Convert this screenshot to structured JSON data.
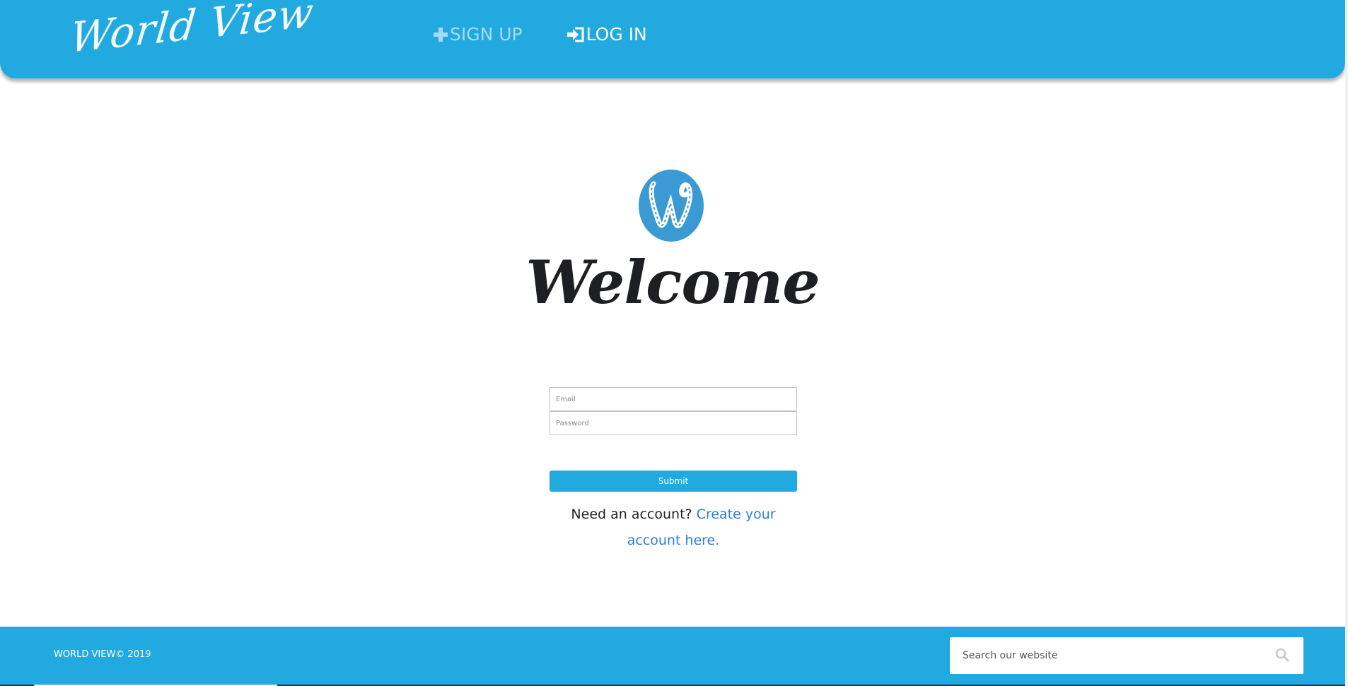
{
  "header": {
    "brand": "World View",
    "nav": {
      "signup_label": "SIGN UP",
      "login_label": "LOG IN"
    }
  },
  "main": {
    "logo_letter": "W",
    "welcome": "Welcome",
    "form": {
      "email_placeholder": "Email",
      "password_placeholder": "Password",
      "submit_label": "Submit"
    },
    "account_prompt": "Need an account?",
    "account_link": "Create your account here."
  },
  "footer": {
    "copyright": "WORLD VIEW© 2019",
    "search_placeholder": "Search our website"
  },
  "colors": {
    "accent": "#22a9df",
    "logo_circle": "#3b9ad3",
    "link": "#2c7fd9",
    "signup_muted": "#a9d9f2"
  },
  "icons": {
    "signup": "plus-icon",
    "login": "login-icon",
    "search": "search-icon"
  }
}
